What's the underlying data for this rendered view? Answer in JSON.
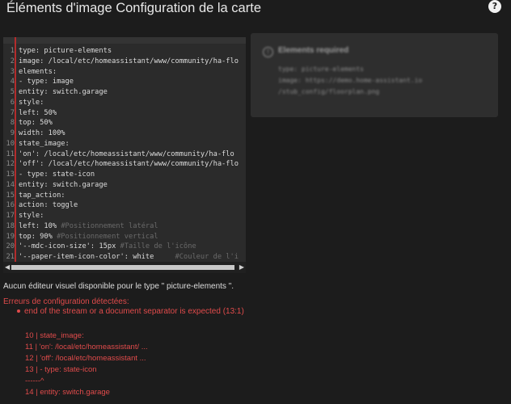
{
  "dialog": {
    "title": "Éléments d'image Configuration de la carte",
    "help_icon": "?"
  },
  "editor": {
    "lines": [
      {
        "n": "1",
        "code": "type: picture-elements",
        "comment": ""
      },
      {
        "n": "2",
        "code": "image: /local/etc/homeassistant/www/community/ha-flo",
        "comment": ""
      },
      {
        "n": "3",
        "code": "elements:",
        "comment": ""
      },
      {
        "n": "4",
        "code": "- type: image",
        "comment": ""
      },
      {
        "n": "5",
        "code": "entity: switch.garage",
        "comment": ""
      },
      {
        "n": "6",
        "code": "style:",
        "comment": ""
      },
      {
        "n": "7",
        "code": "left: 50%",
        "comment": ""
      },
      {
        "n": "8",
        "code": "top: 50%",
        "comment": ""
      },
      {
        "n": "9",
        "code": "width: 100%",
        "comment": ""
      },
      {
        "n": "10",
        "code": "state_image:",
        "comment": ""
      },
      {
        "n": "11",
        "code": "'on': /local/etc/homeassistant/www/community/ha-flo",
        "comment": ""
      },
      {
        "n": "12",
        "code": "'off': /local/etc/homeassistant/www/community/ha-flo",
        "comment": ""
      },
      {
        "n": "13",
        "code": "- type: state-icon",
        "comment": ""
      },
      {
        "n": "14",
        "code": "entity: switch.garage",
        "comment": ""
      },
      {
        "n": "15",
        "code": "tap_action:",
        "comment": ""
      },
      {
        "n": "16",
        "code": "action: toggle",
        "comment": ""
      },
      {
        "n": "17",
        "code": "style:",
        "comment": ""
      },
      {
        "n": "18",
        "code": "left: 10% ",
        "comment": "#Positionnement latéral"
      },
      {
        "n": "19",
        "code": "top: 90% ",
        "comment": "#Positionnement vertical"
      },
      {
        "n": "20",
        "code": "'--mdc-icon-size': 15px ",
        "comment": "#Taille de l'icône"
      },
      {
        "n": "21",
        "code": "'--paper-item-icon-color': white     ",
        "comment": "#Couleur de l'i"
      }
    ],
    "scroll_left": "◀",
    "scroll_right": "▶"
  },
  "preview": {
    "title": "Elements required",
    "lines": [
      "type: picture-elements",
      "image: https://demo.home-assistant.io",
      "/stub_config/floorplan.png"
    ]
  },
  "messages": {
    "no_visual_editor": "Aucun éditeur visuel disponible pour le type \" picture-elements \".",
    "errors_title": "Erreurs de configuration détectées:",
    "error_message": "end of the stream or a document separator is expected (13:1)",
    "snippet": [
      "10 | state_image:",
      "11 | 'on': /local/etc/homeassistant/ ...",
      "12 | 'off': /local/etc/homeassistant ...",
      "13 | - type: state-icon",
      "------^",
      "14 | entity: switch.garage"
    ]
  },
  "colors": {
    "background": "#1c1c1c",
    "editor_bg": "#2b2b2b",
    "error": "#e04b4b",
    "gutter_marker": "#b42c2c"
  }
}
